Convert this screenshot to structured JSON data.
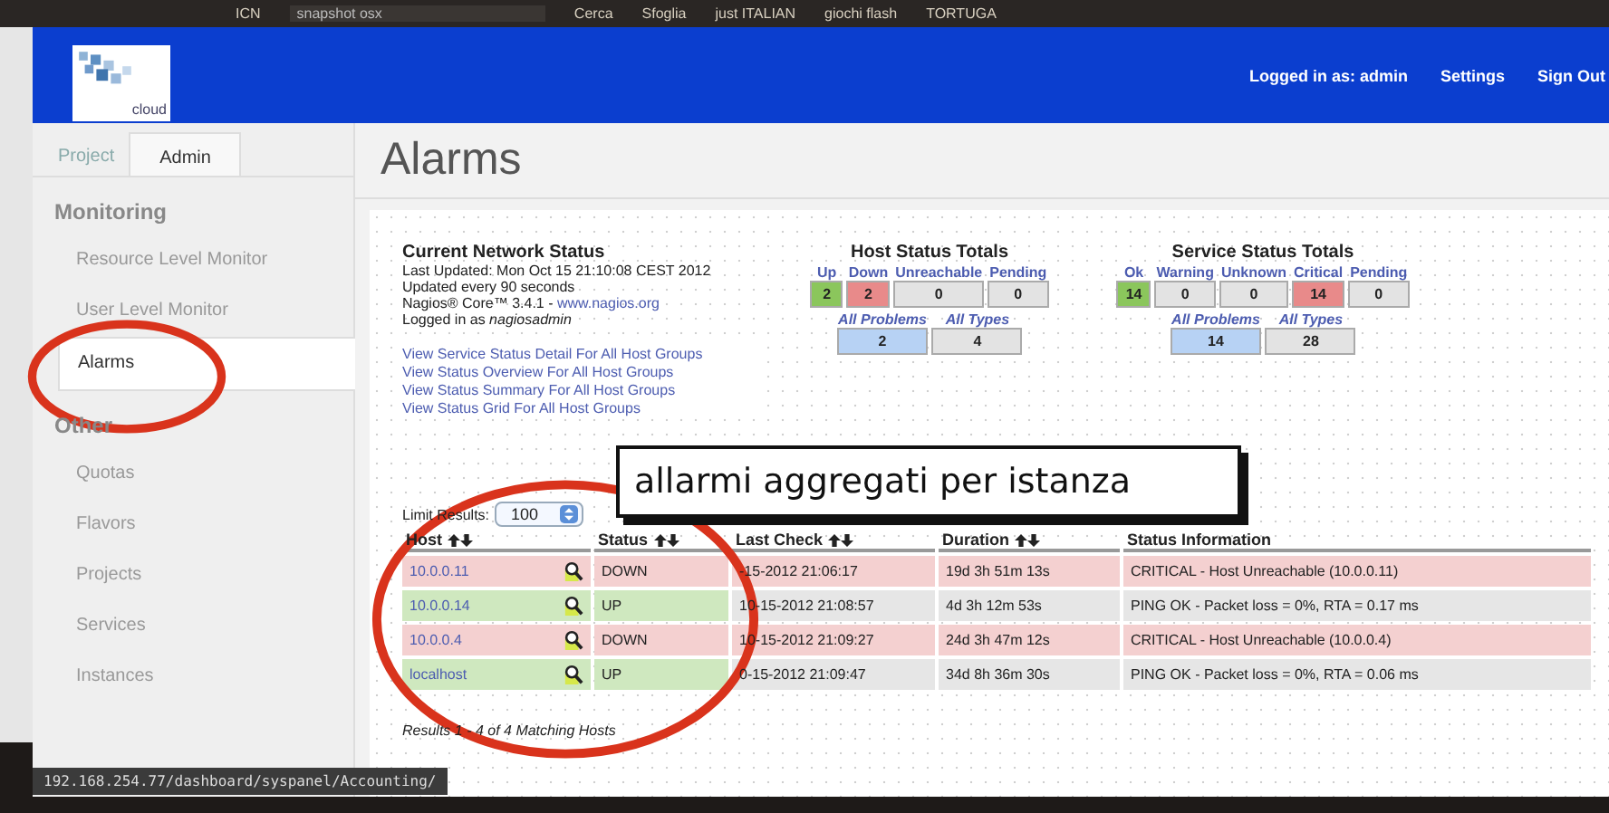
{
  "browser_toolbar": {
    "items": [
      "ICN",
      "snapshot osx",
      "Cerca",
      "Sfoglia",
      "just ITALIAN",
      "giochi flash",
      "TORTUGA"
    ]
  },
  "header": {
    "logo_text": "cloud",
    "user": "Logged in as: admin",
    "links": [
      "Settings",
      "Sign Out"
    ]
  },
  "sidebar": {
    "tabs": [
      {
        "label": "Project",
        "selected": false
      },
      {
        "label": "Admin",
        "selected": true
      }
    ],
    "sections": [
      {
        "title": "Monitoring",
        "items": [
          {
            "label": "Resource Level Monitor",
            "selected": false
          },
          {
            "label": "User Level Monitor",
            "selected": false
          },
          {
            "label": "Alarms",
            "selected": true
          }
        ]
      },
      {
        "title": "Other",
        "items": [
          {
            "label": "Quotas",
            "selected": false
          },
          {
            "label": "Flavors",
            "selected": false
          },
          {
            "label": "Projects",
            "selected": false
          },
          {
            "label": "Services",
            "selected": false
          },
          {
            "label": "Instances",
            "selected": false
          }
        ]
      }
    ]
  },
  "page_title": "Alarms",
  "nagios": {
    "network_status": {
      "title": "Current Network Status",
      "lines": [
        "Last Updated: Mon Oct 15 21:10:08 CEST 2012",
        "Updated every 90 seconds"
      ],
      "version": "Nagios® Core™ 3.4.1 - ",
      "version_link": "www.nagios.org",
      "login": "Logged in as *nagiosadmin*"
    },
    "links": [
      "View Service Status Detail For All Host Groups",
      "View Status Overview For All Host Groups",
      "View Status Summary For All Host Groups",
      "View Status Grid For All Host Groups"
    ],
    "totals": [
      {
        "title": "Host Status Totals",
        "cells": [
          {
            "label": "Up",
            "value": "2",
            "kind": "good"
          },
          {
            "label": "Down",
            "value": "2",
            "kind": "bad"
          },
          {
            "label": "Unreachable",
            "value": "0",
            "kind": "neutral"
          },
          {
            "label": "Pending",
            "value": "0",
            "kind": "neutral"
          }
        ],
        "summary": [
          {
            "label": "All Problems",
            "value": "2",
            "kind": "problems"
          },
          {
            "label": "All Types",
            "value": "4",
            "kind": "neutral"
          }
        ]
      },
      {
        "title": "Service Status Totals",
        "cells": [
          {
            "label": "Ok",
            "value": "14",
            "kind": "good"
          },
          {
            "label": "Warning",
            "value": "0",
            "kind": "neutral"
          },
          {
            "label": "Unknown",
            "value": "0",
            "kind": "neutral"
          },
          {
            "label": "Critical",
            "value": "14",
            "kind": "bad"
          },
          {
            "label": "Pending",
            "value": "0",
            "kind": "neutral"
          }
        ],
        "summary": [
          {
            "label": "All Problems",
            "value": "14",
            "kind": "problems"
          },
          {
            "label": "All Types",
            "value": "28",
            "kind": "neutral"
          }
        ]
      }
    ],
    "limit": {
      "label": "Limit Results:",
      "value": "100"
    },
    "table": {
      "columns": [
        "Host",
        "Status",
        "Last Check",
        "Duration",
        "Status Information"
      ],
      "rows": [
        {
          "host": "10.0.0.11",
          "status": "DOWN",
          "last_check": "-15-2012 21:06:17",
          "duration": "19d 3h 51m 13s",
          "info": "CRITICAL - Host Unreachable (10.0.0.11)",
          "kind": "down"
        },
        {
          "host": "10.0.0.14",
          "status": "UP",
          "last_check": "10-15-2012 21:08:57",
          "duration": "4d 3h 12m 53s",
          "info": "PING OK - Packet loss = 0%, RTA = 0.17 ms",
          "kind": "up"
        },
        {
          "host": "10.0.0.4",
          "status": "DOWN",
          "last_check": "10-15-2012 21:09:27",
          "duration": "24d 3h 47m 12s",
          "info": "CRITICAL - Host Unreachable (10.0.0.4)",
          "kind": "down"
        },
        {
          "host": "localhost",
          "status": "UP",
          "last_check": "0-15-2012 21:09:47",
          "duration": "34d 8h 36m 30s",
          "info": "PING OK - Packet loss = 0%, RTA = 0.06 ms",
          "kind": "up"
        }
      ]
    },
    "results": "Results 1 - 4 of 4 Matching Hosts"
  },
  "annotation": {
    "text": "allarmi aggregati per istanza"
  },
  "status_bar": "192.168.254.77/dashboard/syspanel/Accounting/"
}
